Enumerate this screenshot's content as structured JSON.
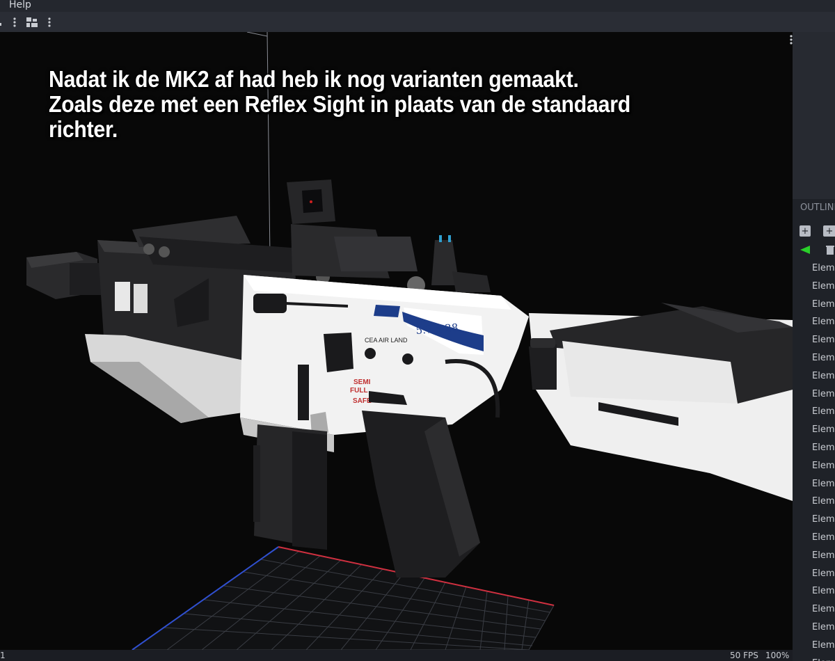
{
  "menubar": {
    "help": "Help"
  },
  "toolbar": {
    "icons": [
      "cube-stack-icon",
      "kebab-icon",
      "layout-icon",
      "kebab-icon"
    ]
  },
  "viewport": {
    "caption": [
      "Nadat ik de MK2 af had heb ik nog varianten gemaakt.",
      "Zoals deze met een Reflex Sight in plaats van de standaard",
      "richter."
    ],
    "decal_caliber": "5.7 x 28",
    "decal_maker": "CEA AIR LAND",
    "decal_semi": "SEMI",
    "decal_full": "FULL",
    "decal_safe": "SAFE"
  },
  "outliner": {
    "title": "OUTLINER",
    "rows": [
      {
        "label": "Element",
        "color": "#f4e46b"
      },
      {
        "label": "Element",
        "color": "#c08ce6"
      },
      {
        "label": "Element",
        "color": "#70e07a"
      },
      {
        "label": "Element",
        "color": "#f08a86"
      },
      {
        "label": "Element",
        "color": "#80b4f2"
      },
      {
        "label": "Element",
        "color": "#80b4f2"
      },
      {
        "label": "Element",
        "color": "#f4e46b"
      },
      {
        "label": "Element",
        "color": "#f0b070"
      },
      {
        "label": "Element",
        "color": "#f0b070"
      },
      {
        "label": "Element",
        "color": "#70e07a"
      },
      {
        "label": "Element",
        "color": "#80b4f2"
      },
      {
        "label": "Element",
        "color": "#70e07a"
      },
      {
        "label": "Element",
        "color": "#f08a86"
      },
      {
        "label": "Element",
        "color": "#f4e46b"
      },
      {
        "label": "Element",
        "color": "#c08ce6"
      },
      {
        "label": "Element",
        "color": "#80b4f2"
      },
      {
        "label": "Element",
        "color": "#f08a86"
      },
      {
        "label": "Element",
        "color": "#78d4f0"
      },
      {
        "label": "Element",
        "color": "#f08a86"
      },
      {
        "label": "Element",
        "color": "#f08a86"
      },
      {
        "label": "Element",
        "color": "#70e07a"
      },
      {
        "label": "Element",
        "color": "#f08a86"
      },
      {
        "label": "Element",
        "color": "#f0b070"
      }
    ]
  },
  "status": {
    "left": "1",
    "fps": "50 FPS",
    "zoom": "100%"
  }
}
